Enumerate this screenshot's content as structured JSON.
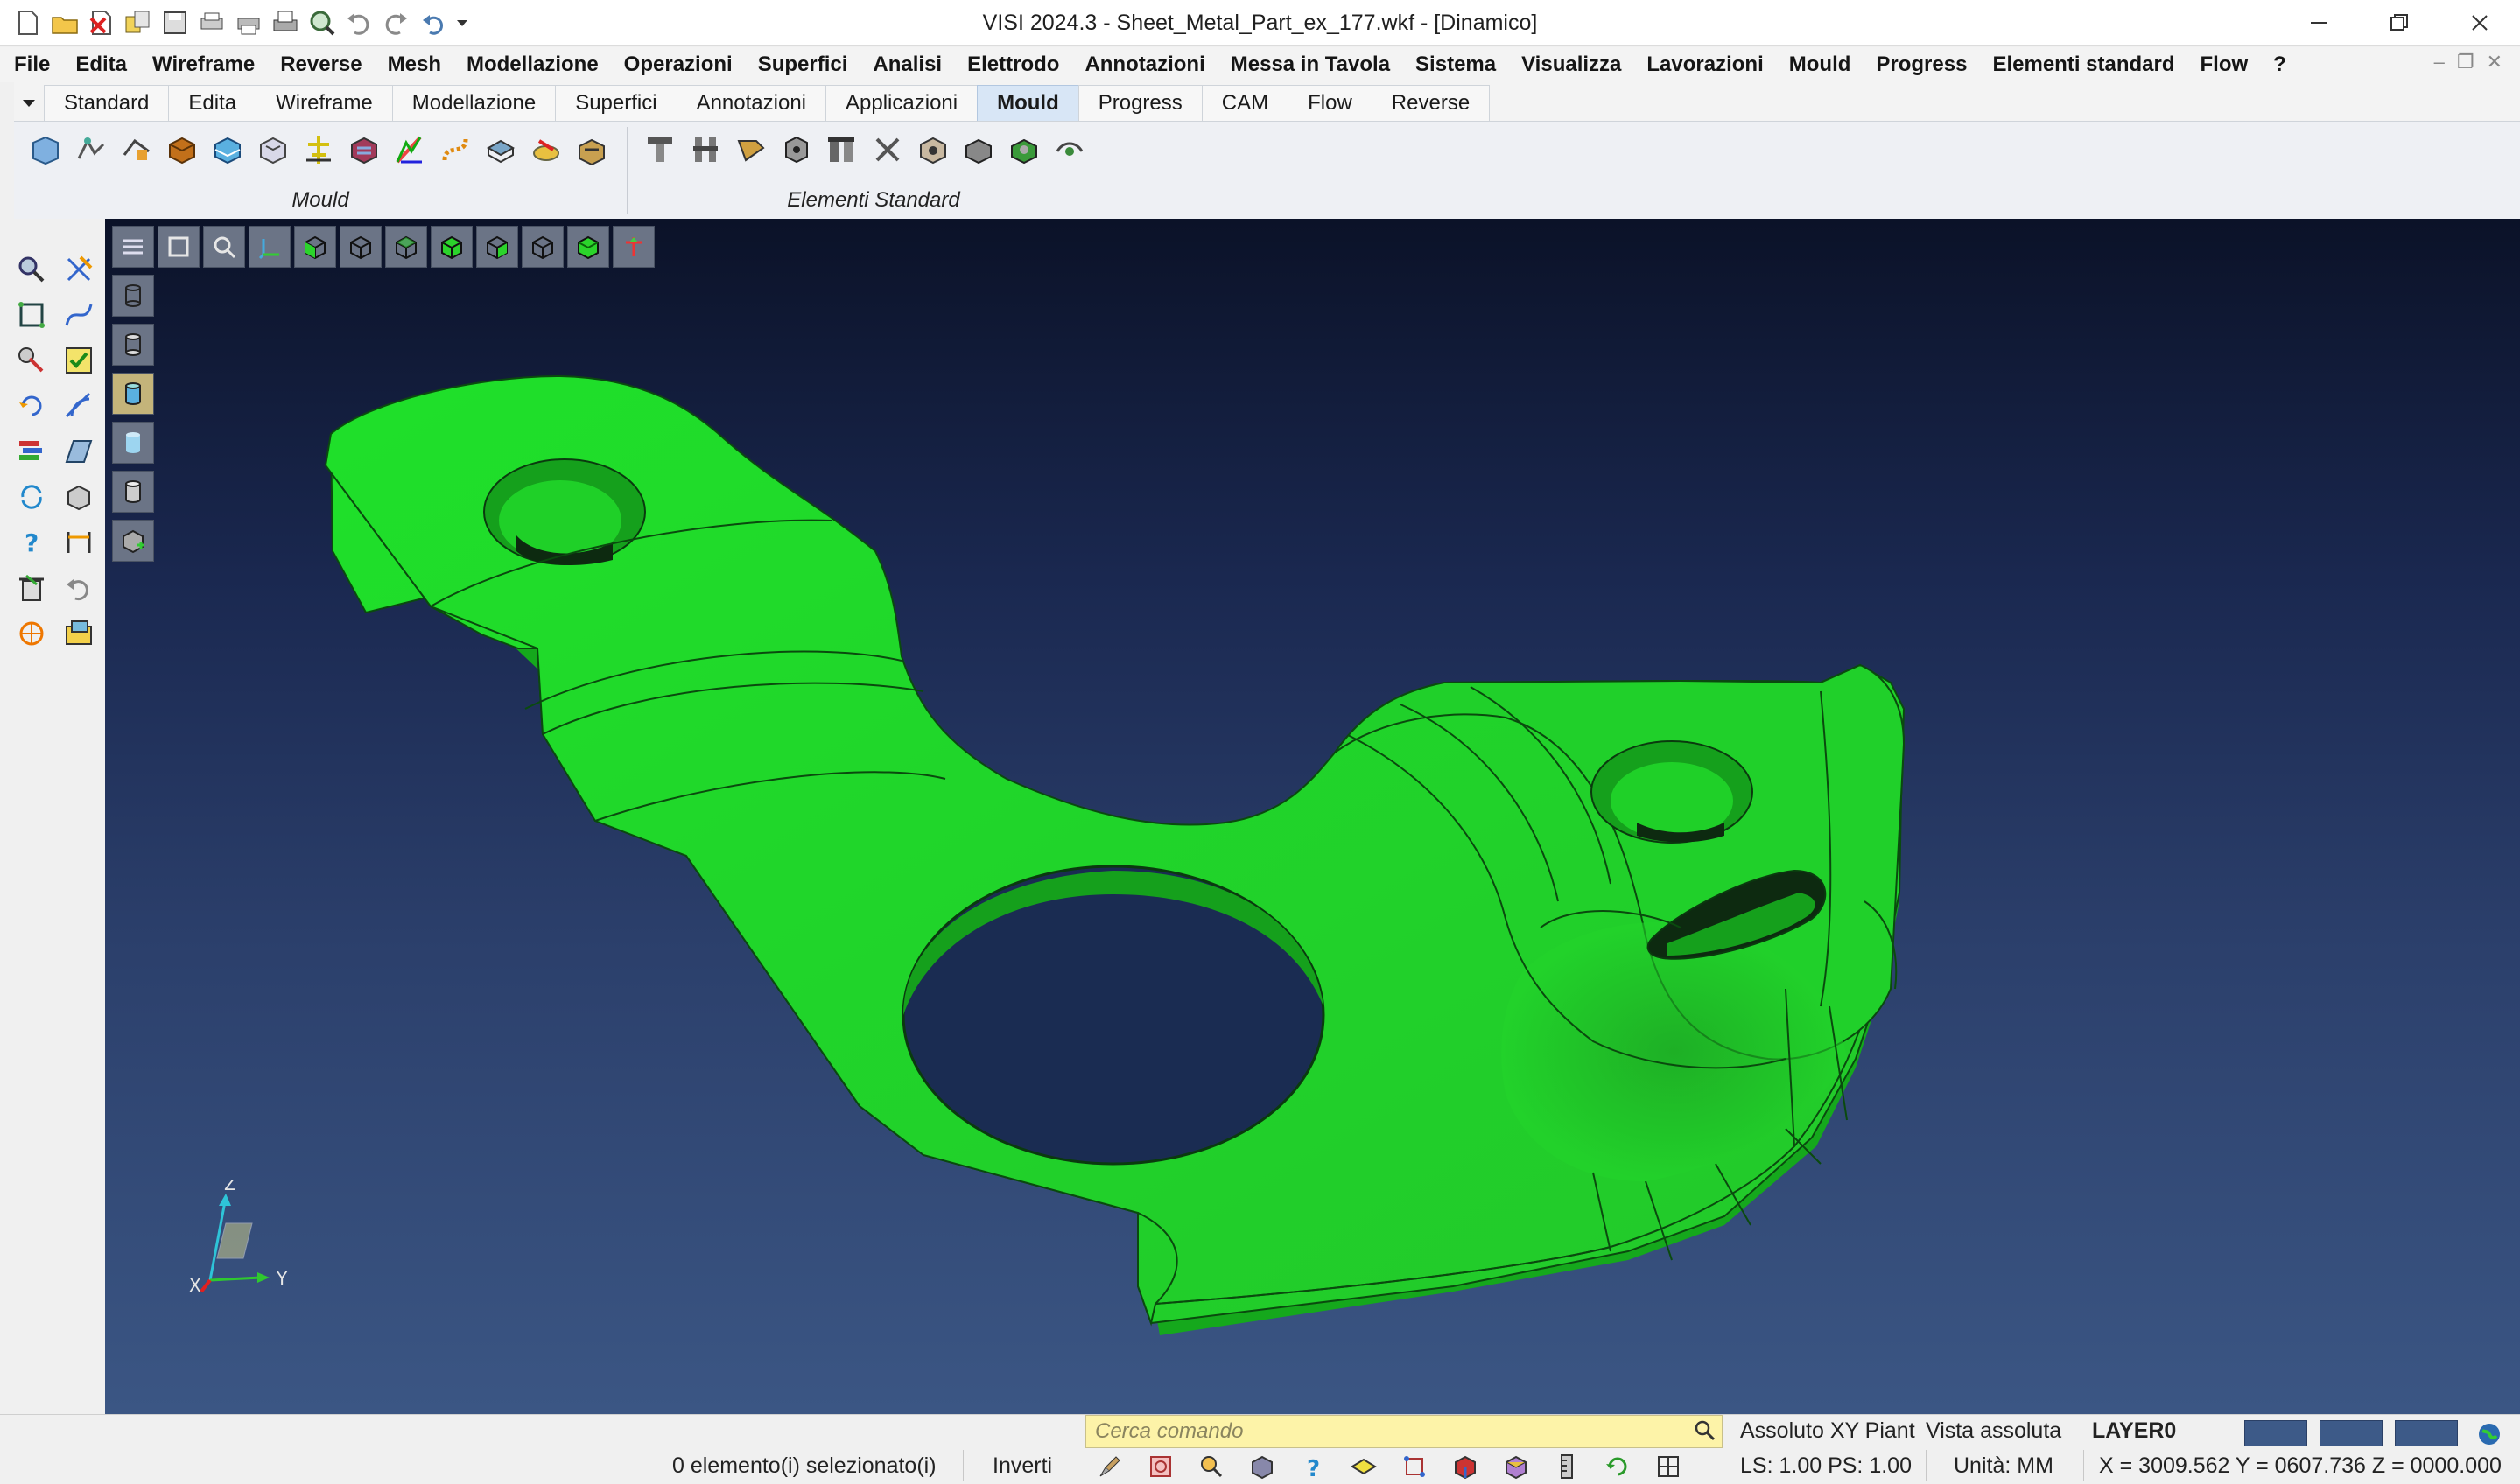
{
  "window": {
    "title": "VISI 2024.3 - Sheet_Metal_Part_ex_177.wkf - [Dinamico]",
    "controls": [
      "minimize",
      "restore",
      "close"
    ]
  },
  "quick_access": [
    "new-file-icon",
    "open-folder-icon",
    "close-file-icon",
    "save-all-icon",
    "save-icon",
    "print-setup-icon",
    "print-icon",
    "printer-icon",
    "zoom-icon",
    "undo-icon",
    "redo-icon",
    "undo-list-icon",
    "customize-dropdown-icon"
  ],
  "menu": [
    "File",
    "Edita",
    "Wireframe",
    "Reverse",
    "Mesh",
    "Modellazione",
    "Operazioni",
    "Superfici",
    "Analisi",
    "Elettrodo",
    "Annotazioni",
    "Messa in Tavola",
    "Sistema",
    "Visualizza",
    "Lavorazioni",
    "Mould",
    "Progress",
    "Elementi standard",
    "Flow",
    "?"
  ],
  "tabs": [
    {
      "label": "Standard",
      "active": false
    },
    {
      "label": "Edita",
      "active": false
    },
    {
      "label": "Wireframe",
      "active": false
    },
    {
      "label": "Modellazione",
      "active": false
    },
    {
      "label": "Superfici",
      "active": false
    },
    {
      "label": "Annotazioni",
      "active": false
    },
    {
      "label": "Applicazioni",
      "active": false
    },
    {
      "label": "Mould",
      "active": true
    },
    {
      "label": "Progress",
      "active": false
    },
    {
      "label": "CAM",
      "active": false
    },
    {
      "label": "Flow",
      "active": false
    },
    {
      "label": "Reverse",
      "active": false
    }
  ],
  "ribbon": {
    "groups": [
      {
        "label": "Mould",
        "icon_count": 13
      },
      {
        "label": "Elementi Standard",
        "icon_count": 10
      }
    ]
  },
  "status": {
    "command_placeholder": "Cerca comando",
    "coordinate_system": "Assoluto XY Piant",
    "view": "Vista assoluta",
    "layer": "LAYER0",
    "selected": "0 elemento(i) selezionato(i)",
    "invert": "Inverti",
    "ls_ps": "LS: 1.00 PS: 1.00",
    "units": "Unità: MM",
    "coordinates": "X = 3009.562 Y = 0607.736 Z = 0000.000"
  },
  "axis": {
    "x": "X",
    "y": "Y",
    "z": "Z"
  },
  "colors": {
    "part": "#1fe02a",
    "viewport_top": "#0b1228",
    "viewport_bottom": "#3b5684",
    "active_tab": "#d8e6f6",
    "command_box": "#fdf3a8"
  }
}
